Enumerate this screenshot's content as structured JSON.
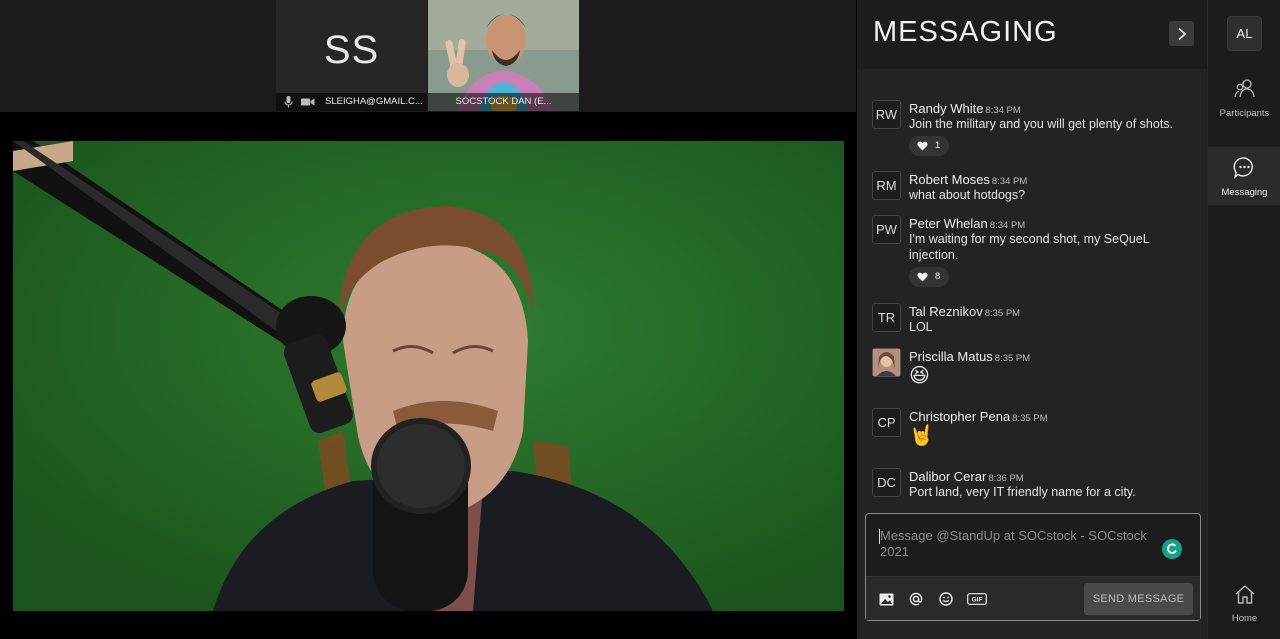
{
  "tiles": [
    {
      "initials": "SS",
      "label": "SLEIGHA@GMAIL.C..."
    },
    {
      "label": "SOCSTOCK DAN (E..."
    }
  ],
  "messaging": {
    "title": "MESSAGING",
    "messages": [
      {
        "initials": "RW",
        "author": "Randy White",
        "time": "8:34 PM",
        "text": "Join the military and you will get plenty of shots.",
        "reaction": {
          "icon": "heart",
          "count": "1"
        }
      },
      {
        "initials": "RM",
        "author": "Robert Moses",
        "time": "8:34 PM",
        "text": "what about hotdogs?"
      },
      {
        "initials": "PW",
        "author": "Peter Whelan",
        "time": "8:34 PM",
        "text": "I'm waiting for my second shot, my SeQueL injection.",
        "reaction": {
          "icon": "heart",
          "count": "8"
        }
      },
      {
        "initials": "TR",
        "author": "Tal Reznikov",
        "time": "8:35 PM",
        "text": "LOL"
      },
      {
        "author": "Priscilla Matus",
        "time": "8:35 PM",
        "text": "😆"
      },
      {
        "initials": "CP",
        "author": "Christopher Pena",
        "time": "8:35 PM",
        "text": "🤘"
      },
      {
        "initials": "DC",
        "author": "Dalibor Cerar",
        "time": "8:36 PM",
        "text": "Port land, very IT friendly name for a city."
      }
    ],
    "composer": {
      "placeholder": "Message @StandUp at SOCstock - SOCstock 2021",
      "send_label": "SEND MESSAGE",
      "gif_label": "GIF"
    }
  },
  "nav": {
    "user_initials": "AL",
    "items": [
      {
        "label": "Participants",
        "icon": "participants-icon"
      },
      {
        "label": "Messaging",
        "icon": "chat-icon",
        "active": true
      },
      {
        "label": "Home",
        "icon": "home-icon"
      }
    ]
  },
  "colors": {
    "panel_bg": "#232323",
    "nav_bg": "#1c1c1c",
    "accent_green": "#15a08a",
    "green_screen": "#246b25"
  }
}
